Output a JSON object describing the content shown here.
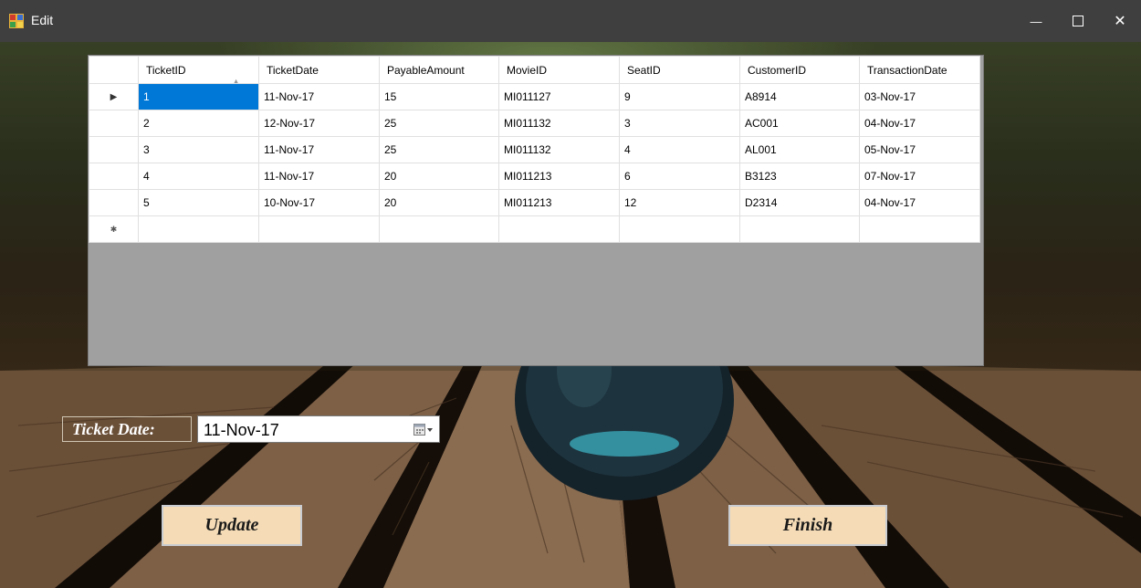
{
  "window": {
    "title": "Edit",
    "minimize_glyph": "—",
    "close_glyph": "✕"
  },
  "grid": {
    "columns": [
      "TicketID",
      "TicketDate",
      "PayableAmount",
      "MovieID",
      "SeatID",
      "CustomerID",
      "TransactionDate"
    ],
    "sorted_column": "TicketID",
    "rows": [
      [
        "1",
        "11-Nov-17",
        "15",
        "MI011127",
        "9",
        "A8914",
        "03-Nov-17"
      ],
      [
        "2",
        "12-Nov-17",
        "25",
        "MI011132",
        "3",
        "AC001",
        "04-Nov-17"
      ],
      [
        "3",
        "11-Nov-17",
        "25",
        "MI011132",
        "4",
        "AL001",
        "05-Nov-17"
      ],
      [
        "4",
        "11-Nov-17",
        "20",
        "MI011213",
        "6",
        "B3123",
        "07-Nov-17"
      ],
      [
        "5",
        "10-Nov-17",
        "20",
        "MI011213",
        "12",
        "D2314",
        "04-Nov-17"
      ]
    ],
    "current_row_marker": "▶",
    "new_row_marker": "✱",
    "sort_glyph": "▲"
  },
  "form": {
    "ticket_date_label": "Ticket Date:",
    "ticket_date_value": "11-Nov-17",
    "update_label": "Update",
    "finish_label": "Finish"
  },
  "colors": {
    "selection": "#0078d7",
    "button_face": "#f5dcb7",
    "titlebar": "#3f3f3f",
    "grid_background": "#a0a0a0"
  }
}
